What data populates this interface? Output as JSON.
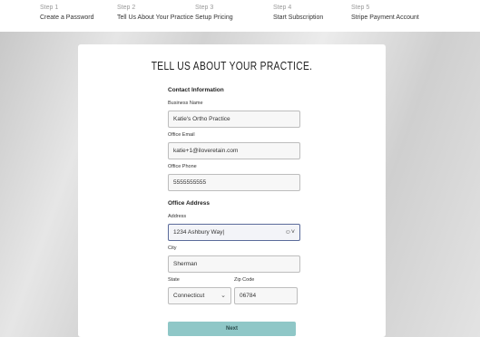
{
  "steps": [
    {
      "num": "Step 1",
      "name": "Create a Password"
    },
    {
      "num": "Step 2",
      "name": "Tell Us About Your Practice"
    },
    {
      "num": "Step 3",
      "name": "Setup Pricing"
    },
    {
      "num": "Step 4",
      "name": "Start Subscription"
    },
    {
      "num": "Step 5",
      "name": "Stripe Payment Account"
    }
  ],
  "form": {
    "title": "TELL US ABOUT YOUR PRACTICE.",
    "contact_section": "Contact Information",
    "business_name_label": "Business Name",
    "business_name_value": "Katie's Ortho Practice",
    "office_email_label": "Office Email",
    "office_email_value": "katie+1@iloveretain.com",
    "office_phone_label": "Office Phone",
    "office_phone_value": "5555555555",
    "address_section": "Office Address",
    "address_label": "Address",
    "address_value": "1234 Ashbury Way|",
    "city_label": "City",
    "city_value": "Sherman",
    "state_label": "State",
    "state_value": "Connecticut",
    "zip_label": "Zip Code",
    "zip_value": "06784",
    "next_label": "Next"
  },
  "icons": {
    "address_autofill": "person-dropdown-icon",
    "state_dropdown": "chevron-down-icon"
  }
}
